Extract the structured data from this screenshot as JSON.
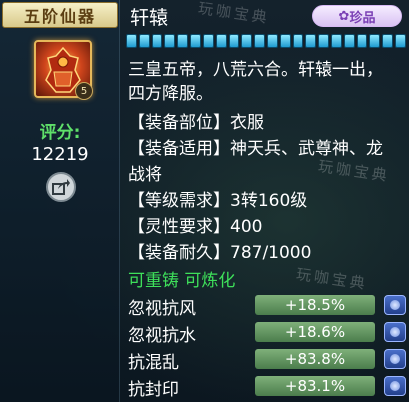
{
  "item": {
    "rank_tag": "五阶仙器",
    "name": "轩辕",
    "badge": "珍品",
    "icon_name": "armor-icon",
    "icon_level": "5",
    "score_label": "评分:",
    "score_value": "12219"
  },
  "watermark": "玩咖宝典",
  "description": {
    "line1": "三皇五帝，八荒六合。轩辕一出，",
    "line2": "四方降服。"
  },
  "attributes": [
    {
      "text": "【装备部位】衣服"
    },
    {
      "text": "【装备适用】神天兵、武尊神、龙"
    },
    {
      "text": "战将"
    },
    {
      "text": "【等级需求】3转160级"
    },
    {
      "text": "【灵性要求】400"
    },
    {
      "text": "【装备耐久】787/1000"
    }
  ],
  "status_line": "可重铸 可炼化",
  "bonuses": [
    {
      "name": "忽视抗风",
      "value": "+18.5%"
    },
    {
      "name": "忽视抗水",
      "value": "+18.6%"
    },
    {
      "name": "抗混乱",
      "value": "+83.8%"
    },
    {
      "name": "抗封印",
      "value": "+83.1%"
    }
  ],
  "durability_fraction": 0.787,
  "colors": {
    "accent_green": "#3ee05a",
    "bar_blue": "#1f9bd0",
    "badge_purple": "#7a3fb5"
  }
}
